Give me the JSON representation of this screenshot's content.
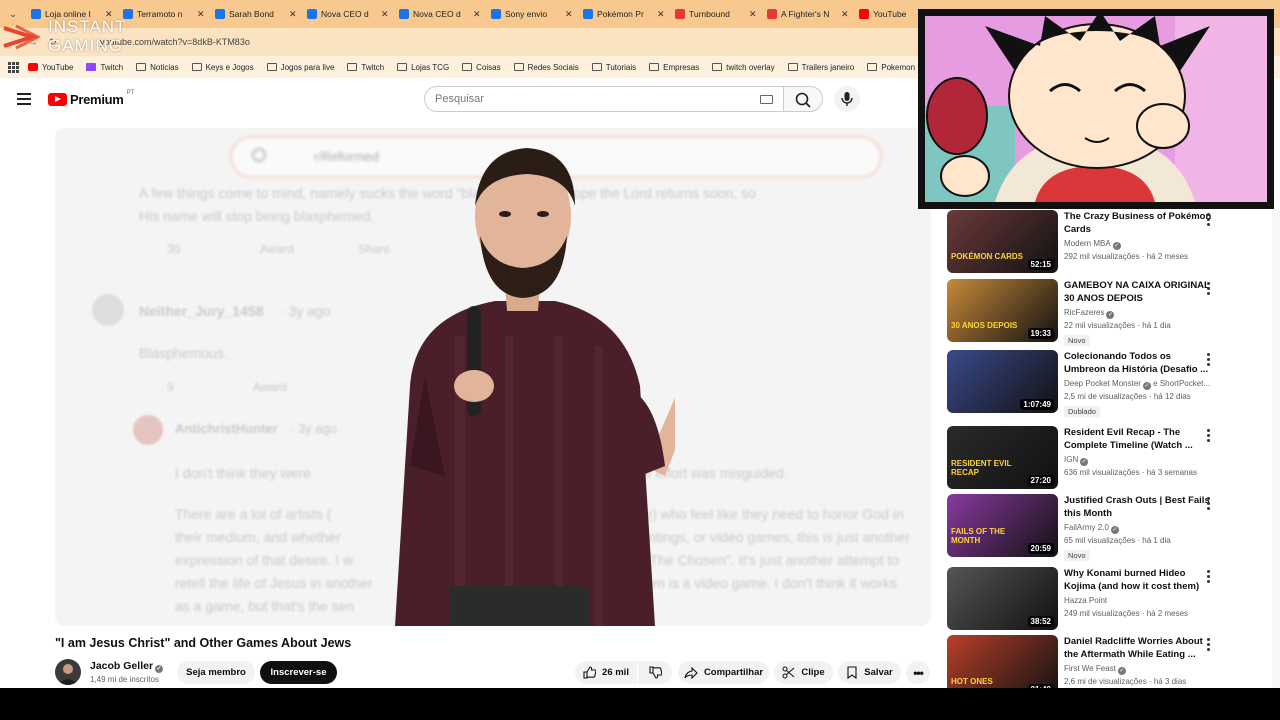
{
  "tabs": [
    {
      "title": "Loja online I",
      "color": "#1a73e8"
    },
    {
      "title": "Terramoto n",
      "color": "#1a73e8"
    },
    {
      "title": "Sarah Bond",
      "color": "#1a73e8"
    },
    {
      "title": "Nova CEO d",
      "color": "#1a73e8"
    },
    {
      "title": "Nova CEO d",
      "color": "#1a73e8"
    },
    {
      "title": "Sony envio",
      "color": "#1a73e8"
    },
    {
      "title": "Pokémon Pr",
      "color": "#1a73e8"
    },
    {
      "title": "Turnbound",
      "color": "#e53935"
    },
    {
      "title": "A Fighter's N",
      "color": "#e53935"
    },
    {
      "title": "YouTube",
      "color": "#ff0000"
    }
  ],
  "address": {
    "url": "youtube.com/watch?v=8dkB-KTM83o"
  },
  "overlay_logo": {
    "line1": "INSTANT",
    "line2": "GAMING"
  },
  "bookmarks": [
    "YouTube",
    "Twitch",
    "Noticias",
    "Keys e Jogos",
    "Jogos para live",
    "Twitch",
    "Lojas TCG",
    "Coisas",
    "Redes Sociais",
    "Tutoriais",
    "Empresas",
    "twitch overlay",
    "Trailers janeiro",
    "Pokemon"
  ],
  "header": {
    "logo_text": "Premium",
    "country": "PT",
    "search_placeholder": "Pesquisar"
  },
  "video_bg": {
    "search_chip": "r/Reformed",
    "search_ghost": "reformed",
    "line1": "A few things come to mind, namely sucks the word \"blasphemous.\" I hope the Lord returns soon, so",
    "line2": "His name will stop being blasphemed.",
    "votes1": "30",
    "award": "Award",
    "share": "Share",
    "user1": "Neither_Jury_1458",
    "time1": "· 3y ago",
    "comment2": "Blasphemous.",
    "votes2": "9",
    "user2": "AntichristHunter",
    "time2": "· 3y ago",
    "c3a": "I don't think they were",
    "c3b": "whole effort was misguided.",
    "c4a": "There are a lot of artists (",
    "c4b": "sense) who feel like they need to honor God in",
    "c4c": "their medium, and whether",
    "c4d": "s, paintings, or video games, this is just another",
    "c4e": "expression of that desire. I w",
    "c4f": "how \"The Chosen\". It's just another attempt to",
    "c4g": "retell the life of Jesus in another",
    "c4h": "medium is a video game. I don't think it works",
    "c4i": "as a game, but that's the sen"
  },
  "video": {
    "title": "\"I am Jesus Christ\" and Other Games About Jews",
    "channel": "Jacob Geller",
    "subscribers": "1,49 mi de inscritos",
    "member_label": "Seja membro",
    "subscribe_label": "Inscrever-se",
    "likes": "26 mil",
    "share_label": "Compartilhar",
    "clip_label": "Clipe",
    "save_label": "Salvar"
  },
  "sidebar": [
    {
      "title": "The Crazy Business of Pokémon Cards",
      "channel": "Modern MBA",
      "verified": true,
      "meta": "292 mil visualizações · há 2 meses",
      "duration": "52:15",
      "badge": "",
      "thumb": "#6b3a3a",
      "thumb_text": "POKÉMON CARDS"
    },
    {
      "title": "GAMEBOY NA CAIXA ORIGINAL 30 ANOS DEPOIS",
      "channel": "RicFazeres",
      "verified": true,
      "meta": "22 mil visualizações · há 1 dia",
      "duration": "19:33",
      "badge": "Novo",
      "thumb": "#c88a3a",
      "thumb_text": "30 ANOS DEPOIS"
    },
    {
      "title": "Colecionando Todos os Umbreon da História (Desafio ...",
      "channel": "Deep Pocket Monster",
      "verified": true,
      "channel_extra": "e ShortPocket...",
      "meta": "2,5 mi de visualizações · há 12 dias",
      "duration": "1:07:49",
      "badge": "Dublado",
      "thumb": "#3a4a8a",
      "thumb_text": ""
    },
    {
      "title": "Resident Evil Recap - The Complete Timeline (Watch ...",
      "channel": "IGN",
      "verified": true,
      "meta": "636 mil visualizações · há 3 semanas",
      "duration": "27:20",
      "badge": "",
      "thumb": "#2a2a2a",
      "thumb_text": "RESIDENT EVIL RECAP"
    },
    {
      "title": "Justified Crash Outs | Best Fails this Month",
      "channel": "FailArmy 2.0",
      "verified": true,
      "meta": "65 mil visualizações · há 1 dia",
      "duration": "20:59",
      "badge": "Novo",
      "thumb": "#8a3aa0",
      "thumb_text": "FAILS OF THE MONTH"
    },
    {
      "title": "Why Konami burned Hideo Kojima (and how it cost them)",
      "channel": "Hazza Point",
      "verified": false,
      "meta": "249 mil visualizações · há 2 meses",
      "duration": "38:52",
      "badge": "",
      "thumb": "#555555",
      "thumb_text": ""
    },
    {
      "title": "Daniel Radcliffe Worries About the Aftermath While Eating ...",
      "channel": "First We Feast",
      "verified": true,
      "meta": "2,6 mi de visualizações · há 3 dias",
      "duration": "21:40",
      "badge": "",
      "thumb": "#b8402a",
      "thumb_text": "HOT ONES"
    }
  ]
}
